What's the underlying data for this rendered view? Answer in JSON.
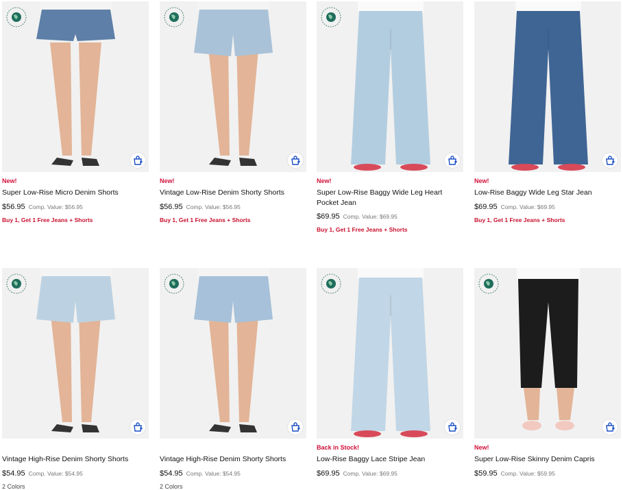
{
  "colors": {
    "accent": "#d0103a",
    "promo": "#c8102e",
    "image_bg": "#f1f1f1",
    "bag_icon": "#1a4fc4"
  },
  "products": [
    {
      "badge": "New!",
      "name": "Super Low-Rise Micro Denim Shorts",
      "price": "$56.95",
      "comp": "Comp. Value: $56.95",
      "promo": "Buy 1, Get 1 Free Jeans + Shorts",
      "colors_text": "",
      "eco_badge": true,
      "garment": "micro-shorts",
      "denim": "#5d7fa8"
    },
    {
      "badge": "New!",
      "name": "Vintage Low-Rise Denim Shorty Shorts",
      "price": "$56.95",
      "comp": "Comp. Value: $56.95",
      "promo": "Buy 1, Get 1 Free Jeans + Shorts",
      "colors_text": "",
      "eco_badge": true,
      "garment": "shorts",
      "denim": "#a9c2d8"
    },
    {
      "badge": "New!",
      "name": "Super Low-Rise Baggy Wide Leg Heart Pocket Jean",
      "price": "$69.95",
      "comp": "Comp. Value: $69.95",
      "promo": "Buy 1, Get 1 Free Jeans + Shorts",
      "colors_text": "",
      "eco_badge": true,
      "garment": "wide-jean",
      "denim": "#b3cde0"
    },
    {
      "badge": "New!",
      "name": "Low-Rise Baggy Wide Leg Star Jean",
      "price": "$69.95",
      "comp": "Comp. Value: $69.95",
      "promo": "Buy 1, Get 1 Free Jeans + Shorts",
      "colors_text": "",
      "eco_badge": false,
      "garment": "wide-jean",
      "denim": "#3f6594"
    },
    {
      "badge": "",
      "name": "Vintage High-Rise Denim Shorty Shorts",
      "price": "$54.95",
      "comp": "Comp. Value: $54.95",
      "promo": "",
      "colors_text": "2 Colors",
      "eco_badge": true,
      "garment": "shorts",
      "denim": "#bcd2e2"
    },
    {
      "badge": "",
      "name": "Vintage High-Rise Denim Shorty Shorts",
      "price": "$54.95",
      "comp": "Comp. Value: $54.95",
      "promo": "",
      "colors_text": "2 Colors",
      "eco_badge": true,
      "garment": "shorts",
      "denim": "#a6c1d9"
    },
    {
      "badge": "Back in Stock!",
      "name": "Low-Rise Baggy Lace Stripe Jean",
      "price": "$69.95",
      "comp": "Comp. Value: $69.95",
      "promo": "",
      "colors_text": "",
      "eco_badge": true,
      "garment": "wide-jean",
      "denim": "#c1d6e6"
    },
    {
      "badge": "New!",
      "name": "Super Low-Rise Skinny Denim Capris",
      "price": "$59.95",
      "comp": "Comp. Value: $59.95",
      "promo": "",
      "colors_text": "",
      "eco_badge": true,
      "garment": "capris",
      "denim": "#1c1c1c"
    }
  ]
}
